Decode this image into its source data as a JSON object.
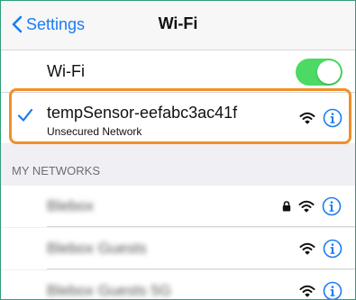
{
  "navbar": {
    "back_label": "Settings",
    "title": "Wi-Fi"
  },
  "wifi_toggle": {
    "label": "Wi-Fi",
    "on": true
  },
  "current_network": {
    "name": "tempSensor-eefabc3ac41f",
    "subtitle": "Unsecured Network"
  },
  "my_networks": {
    "header": "MY NETWORKS",
    "items": [
      {
        "name": "Blebox",
        "locked": true
      },
      {
        "name": "Blebox Guests",
        "locked": false
      },
      {
        "name": "Blebox Guests 5G",
        "locked": false
      }
    ]
  },
  "colors": {
    "accent": "#1a7cf2",
    "toggle_on": "#4cd964",
    "highlight": "#f0902a",
    "border": "#2e9d7b"
  }
}
